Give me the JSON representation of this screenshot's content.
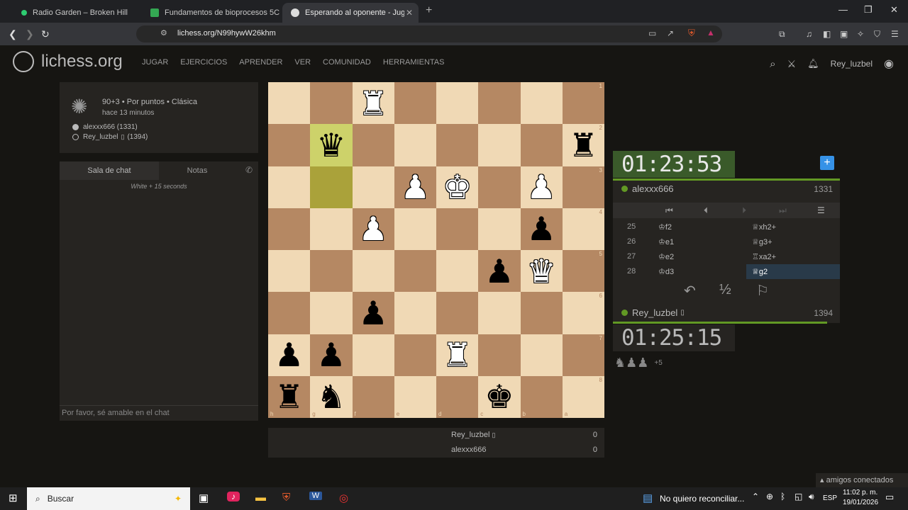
{
  "browser": {
    "tabs": [
      {
        "title": "Radio Garden – Broken Hill",
        "color": "#2ecc71"
      },
      {
        "title": "Fundamentos de bioprocesos 5C",
        "color": "#34a853"
      },
      {
        "title": "Esperando al oponente - Jugar a",
        "color": "#dddddd"
      }
    ],
    "url": "lichess.org/N99hywW26khm"
  },
  "site": {
    "logo": "lichess.org",
    "nav": [
      "JUGAR",
      "EJERCICIOS",
      "APRENDER",
      "VER",
      "COMUNIDAD",
      "HERRAMIENTAS"
    ],
    "username": "Rey_luzbel"
  },
  "game": {
    "title": "90+3 • Por puntos • Clásica",
    "ago": "hace 13 minutos",
    "white_line": "alexxx666 (1331)",
    "black_line": "Rey_luzbel",
    "black_rating": "(1394)"
  },
  "chat": {
    "tab_chat": "Sala de chat",
    "tab_notes": "Notas",
    "message": "White + 15 seconds",
    "placeholder": "Por favor, sé amable en el chat"
  },
  "board": {
    "rows": [
      [
        "",
        "",
        "wR",
        "",
        "",
        "",
        "",
        ""
      ],
      [
        "",
        "bQ",
        "",
        "",
        "",
        "",
        "",
        "bR"
      ],
      [
        "",
        "",
        "",
        "wP",
        "wK",
        "",
        "wP",
        ""
      ],
      [
        "",
        "",
        "wP",
        "",
        "",
        "",
        "bP",
        ""
      ],
      [
        "",
        "",
        "",
        "",
        "",
        "bP",
        "wQ",
        ""
      ],
      [
        "",
        "",
        "bP",
        "",
        "",
        "",
        "",
        ""
      ],
      [
        "bP",
        "bP",
        "",
        "",
        "wR",
        "",
        "",
        ""
      ],
      [
        "bR",
        "bN",
        "",
        "",
        "",
        "bK",
        "",
        ""
      ]
    ],
    "rank_labels": [
      "1",
      "2",
      "3",
      "4",
      "5",
      "6",
      "7",
      "8"
    ],
    "file_labels": [
      "h",
      "g",
      "f",
      "e",
      "d",
      "c",
      "b",
      "a"
    ],
    "highlights": [
      [
        1,
        1
      ],
      [
        2,
        1
      ]
    ]
  },
  "score": [
    {
      "name": "Rey_luzbel",
      "points": "0"
    },
    {
      "name": "alexxx666",
      "points": "0"
    }
  ],
  "opponent": {
    "name": "alexxx666",
    "rating": "1331",
    "clock": "01:23:53"
  },
  "player": {
    "name": "Rey_luzbel",
    "rating": "1394",
    "clock": "01:25:15"
  },
  "moves": [
    {
      "num": "25",
      "white": "♔f2",
      "black": "♕xh2+"
    },
    {
      "num": "26",
      "white": "♔e1",
      "black": "♕g3+"
    },
    {
      "num": "27",
      "white": "♔e2",
      "black": "♖xa2+"
    },
    {
      "num": "28",
      "white": "♔d3",
      "black": "♕g2"
    }
  ],
  "material": {
    "pieces": "♞♟♟",
    "diff": "+5"
  },
  "friends": "amigos conectados",
  "taskbar": {
    "search": "Buscar",
    "notification": "No quiero reconciliar...",
    "lang": "ESP",
    "time": "11:02 p. m.",
    "date": "19/01/2026"
  }
}
